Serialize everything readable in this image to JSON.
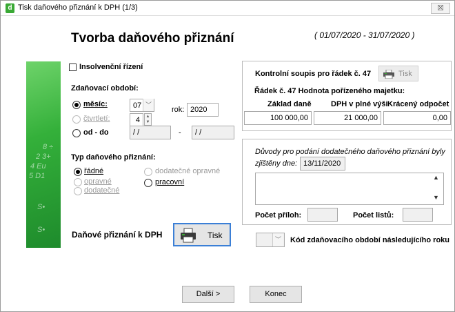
{
  "window": {
    "title": "Tisk daňového přiznání k DPH (1/3)",
    "close_glyph": "☒",
    "app_icon_letter": "d"
  },
  "header": {
    "title": "Tvorba daňového  přiznání",
    "period": "( 01/07/2020 - 31/07/2020 )"
  },
  "insolvency": {
    "label": "Insolvenční řízení",
    "checked": false
  },
  "tax_period": {
    "heading": "Zdaňovací období:",
    "month_label": "měsíc:",
    "quarter_label": "čtvrtletí:",
    "range_label": "od - do",
    "month_value": "07",
    "quarter_value": "4",
    "year_label": "rok:",
    "year_value": "2020",
    "from_value": "/ /",
    "to_value": "/ /",
    "dash": "-",
    "selected": "month"
  },
  "return_type": {
    "heading": "Typ daňového přiznání:",
    "regular": "řádné",
    "corrective": "opravné",
    "additional": "dodatečné",
    "additional_corrective": "dodatečné opravné",
    "working": "pracovní",
    "selected": "regular"
  },
  "print_main": {
    "label": "Daňové přiznání k DPH",
    "button": "Tisk"
  },
  "control": {
    "title": "Kontrolní soupis pro řádek č. 47",
    "print_button": "Tisk",
    "row_title": "Řádek č. 47 Hodnota pořízeného majetku:",
    "col_base": "Základ daně",
    "col_vat": "DPH v plné výši",
    "col_reduced": "Krácený odpočet",
    "val_base": "100 000,00",
    "val_vat": "21 000,00",
    "val_reduced": "0,00"
  },
  "additional": {
    "reasons_label": "Důvody pro podání dodatečného daňového přiznání byly",
    "found_label": "zjištěny dne:",
    "found_date": "13/11/2020",
    "attachments_label": "Počet příloh:",
    "sheets_label": "Počet listů:"
  },
  "next_period_code": {
    "label": "Kód zdaňovacího období následujícího roku"
  },
  "footer": {
    "next_button": "Další >",
    "end_button": "Konec"
  },
  "colors": {
    "accent_green": "#3aa935"
  }
}
